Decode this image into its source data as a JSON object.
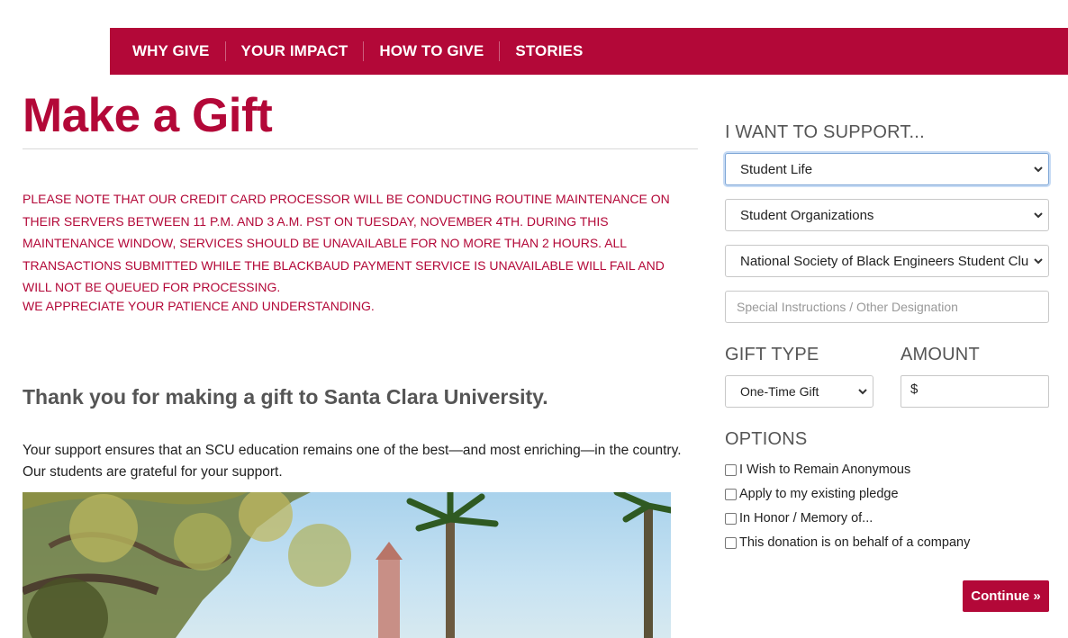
{
  "nav": {
    "items": [
      "WHY GIVE",
      "YOUR IMPACT",
      "HOW TO GIVE",
      "STORIES"
    ]
  },
  "page": {
    "title": "Make a Gift",
    "notice": "PLEASE NOTE THAT OUR CREDIT CARD PROCESSOR WILL BE CONDUCTING ROUTINE MAINTENANCE ON THEIR SERVERS BETWEEN 11 P.M. AND 3 A.M. PST ON TUESDAY, NOVEMBER 4TH. DURING THIS MAINTENANCE WINDOW, SERVICES SHOULD BE UNAVAILABLE FOR NO MORE THAN 2 HOURS. ALL TRANSACTIONS SUBMITTED WHILE THE BLACKBAUD PAYMENT SERVICE IS UNAVAILABLE WILL FAIL AND WILL NOT BE QUEUED FOR PROCESSING.",
    "notice_2": "WE APPRECIATE YOUR PATIENCE AND UNDERSTANDING.",
    "thanks_heading": "Thank you for making a gift to Santa Clara University.",
    "support_text": "Your support ensures that an SCU education remains one of the best—and most enriching—in the country.  Our students are grateful for your support."
  },
  "form": {
    "support_label": "I WANT TO SUPPORT...",
    "select_1": "Student Life",
    "select_2": "Student Organizations",
    "select_3": "National Society of Black Engineers Student Club",
    "special_placeholder": "Special Instructions / Other Designation",
    "gift_type_label": "GIFT TYPE",
    "gift_type_value": "One-Time Gift",
    "amount_label": "AMOUNT",
    "amount_prefix": "$",
    "options_label": "OPTIONS",
    "options": [
      "I Wish to Remain Anonymous",
      "Apply to my existing pledge",
      "In Honor / Memory of...",
      "This donation is on behalf of a company"
    ],
    "continue_label": "Continue »"
  },
  "colors": {
    "brand": "#b30838",
    "heading_gray": "#555555"
  }
}
